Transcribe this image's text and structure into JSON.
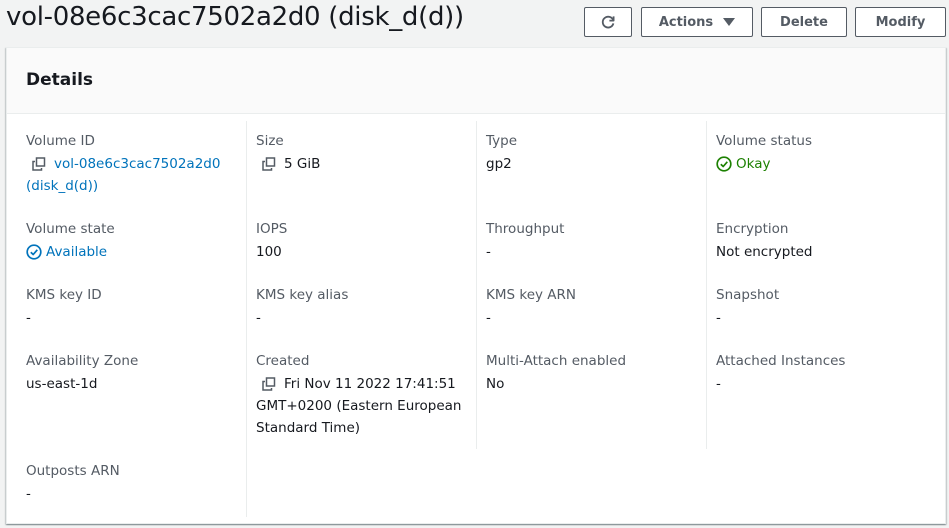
{
  "header": {
    "title": "vol-08e6c3cac7502a2d0 (disk_d(d))"
  },
  "toolbar": {
    "refresh_icon": "refresh-icon",
    "actions_label": "Actions",
    "delete_label": "Delete",
    "modify_label": "Modify"
  },
  "details": {
    "title": "Details",
    "volume_id": {
      "label": "Volume ID",
      "value_line1": "vol-08e6c3cac7502a2d0",
      "value_line2": "(disk_d(d))"
    },
    "size": {
      "label": "Size",
      "value": "5 GiB"
    },
    "type": {
      "label": "Type",
      "value": "gp2"
    },
    "volume_status": {
      "label": "Volume status",
      "value": "Okay"
    },
    "volume_state": {
      "label": "Volume state",
      "value": "Available"
    },
    "iops": {
      "label": "IOPS",
      "value": "100"
    },
    "throughput": {
      "label": "Throughput",
      "value": "-"
    },
    "encryption": {
      "label": "Encryption",
      "value": "Not encrypted"
    },
    "kms_key_id": {
      "label": "KMS key ID",
      "value": "-"
    },
    "kms_key_alias": {
      "label": "KMS key alias",
      "value": "-"
    },
    "kms_key_arn": {
      "label": "KMS key ARN",
      "value": "-"
    },
    "snapshot": {
      "label": "Snapshot",
      "value": "-"
    },
    "availability_zone": {
      "label": "Availability Zone",
      "value": "us-east-1d"
    },
    "created": {
      "label": "Created",
      "value_line1": "Fri Nov 11 2022 17:41:51",
      "value_line2": "GMT+0200 (Eastern European",
      "value_line3": "Standard Time)"
    },
    "multi_attach": {
      "label": "Multi-Attach enabled",
      "value": "No"
    },
    "attached_instances": {
      "label": "Attached Instances",
      "value": "-"
    },
    "outposts_arn": {
      "label": "Outposts ARN",
      "value": "-"
    }
  },
  "colors": {
    "link": "#0073bb",
    "success": "#1d8102",
    "border": "#eaeded",
    "button_border": "#545b64"
  }
}
